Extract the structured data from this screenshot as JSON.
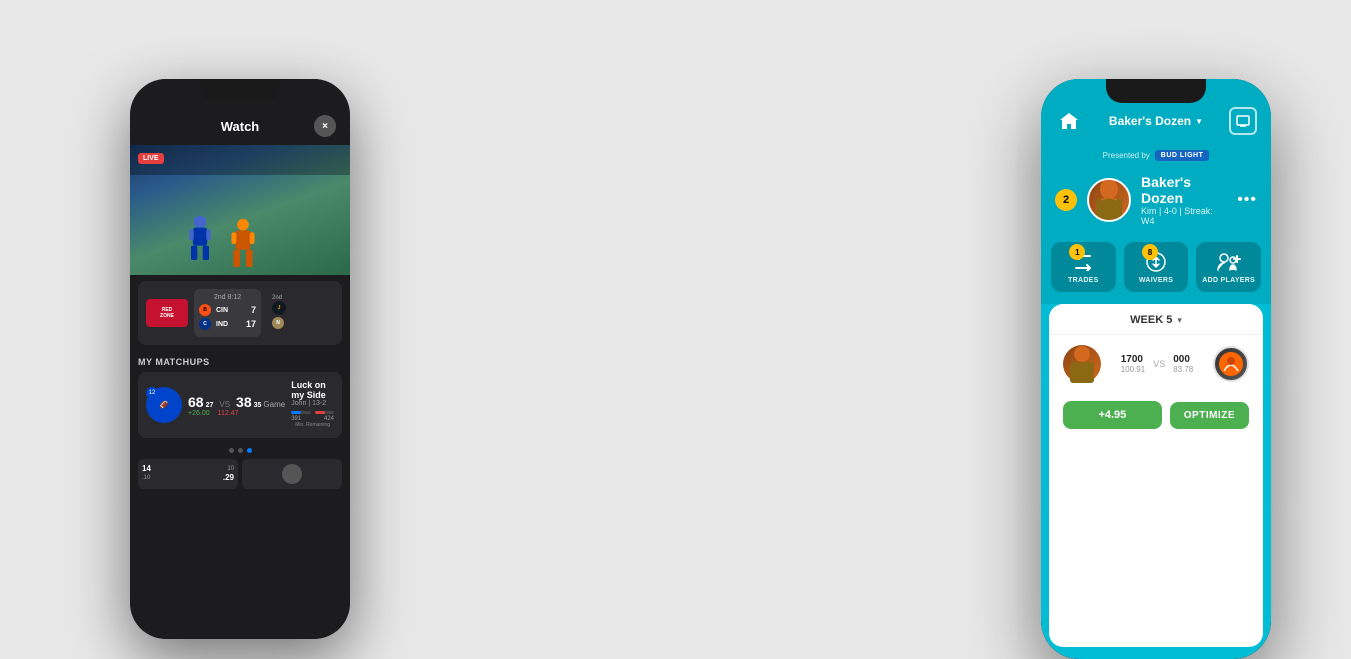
{
  "background_color": "#e8e8e8",
  "phones": {
    "left": {
      "watch_modal": {
        "title": "Watch",
        "close_btn": "×",
        "live_badge": "LIVE",
        "game_card": {
          "redzone_text": "RED\nZONE",
          "score_header": "2nd 8:12",
          "teams": [
            {
              "abbr": "CIN",
              "color": "#FB4F14",
              "score": "7"
            },
            {
              "abbr": "IND",
              "color": "#003087",
              "score": "17"
            }
          ],
          "second_header": "2nd",
          "second_teams": [
            {
              "abbr": "JAX",
              "color": "#101820"
            },
            {
              "abbr": "NO",
              "color": "#9F8958"
            }
          ]
        }
      },
      "my_matchups": {
        "section_title": "MY MATCHUPS",
        "matchup": {
          "team_num": "12",
          "score1": "68",
          "score1_dec": "27",
          "score1_change": "+26.00",
          "score2": "38",
          "score2_dec": "35",
          "score2_change": "112.47",
          "vs_label": "VS",
          "game_label": "Game",
          "team_name": "Luck on my Side",
          "team_record": "John | 13-2",
          "remaining_label": "Min. Remaining",
          "bar1_val": "391",
          "bar2_val": "424",
          "bar1_pct": 48,
          "bar2_pct": 52,
          "bar1_color": "#007AFF",
          "bar2_color": "#e53e3e"
        }
      },
      "dots": [
        false,
        false,
        true
      ],
      "bottom_cards": [
        {
          "score1": "14.10",
          "score2": "10.29",
          "label": "G"
        }
      ]
    },
    "right": {
      "header": {
        "home_icon": "⌂",
        "league_name": "Baker's Dozen",
        "tv_icon": "📺",
        "chevron": "▼"
      },
      "presented_by": {
        "label": "Presented by",
        "brand": "BUD LIGHT"
      },
      "team_section": {
        "rank": "2",
        "team_name": "Baker's Dozen",
        "owner": "Kim",
        "record": "4-0",
        "streak": "Streak: W4",
        "more": "•••"
      },
      "actions": [
        {
          "icon": "⇄",
          "badge": "1",
          "label": "TRADES"
        },
        {
          "icon": "↕",
          "badge": "8",
          "label": "WAIVERS"
        },
        {
          "icon": "👤+",
          "label": "ADD PLAYERS",
          "has_badge": false
        }
      ],
      "matchup_card": {
        "week_label": "WEEK 5",
        "chevron": "▾",
        "score1": "17",
        "score1_dec": "00",
        "score1_sub": "100.91",
        "vs": "VS",
        "score2": "0",
        "score2_dec": "00",
        "score2_sub": "83.78",
        "plus_score": "+4.95",
        "optimize_label": "OPTIMIZE"
      }
    }
  }
}
